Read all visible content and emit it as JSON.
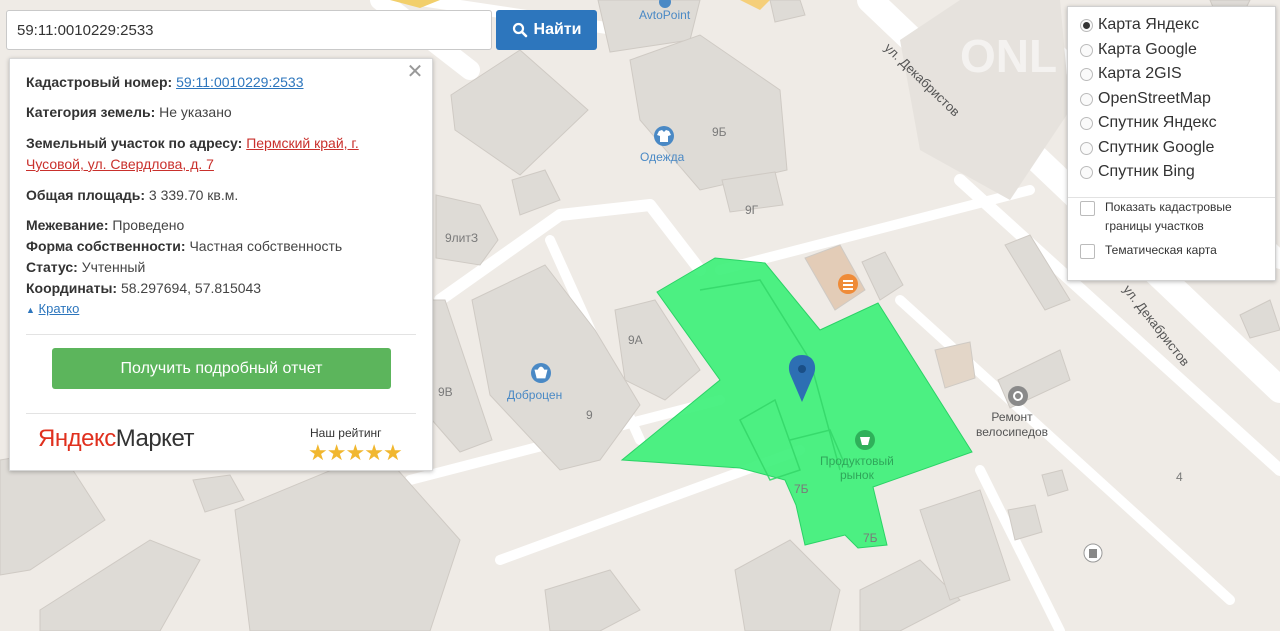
{
  "search": {
    "value": "59:11:0010229:2533",
    "button_label": "Найти",
    "button_icon": "search-icon"
  },
  "info": {
    "cadastral_label": "Кадастровый номер:",
    "cadastral_value": "59:11:0010229:2533",
    "category_label": "Категория земель:",
    "category_value": "Не указано",
    "address_label": "Земельный участок по адресу:",
    "address_line1": "Пермский край, г.",
    "address_line2": "Чусовой, ул. Свердлова, д. 7",
    "area_label": "Общая площадь:",
    "area_value": "3 339.70 кв.м.",
    "survey_label": "Межевание:",
    "survey_value": "Проведено",
    "ownership_label": "Форма собственности:",
    "ownership_value": "Частная собственность",
    "status_label": "Статус:",
    "status_value": "Учтенный",
    "coords_label": "Координаты:",
    "coords_value": "58.297694, 57.815043",
    "collapse_label": "Кратко",
    "report_button": "Получить подробный отчет",
    "ad_logo_part1": "Яндекс",
    "ad_logo_part2": "Маркет",
    "rating_label": "Наш рейтинг",
    "rating_stars": 5
  },
  "layers": {
    "options": [
      {
        "label": "Карта Яндекс",
        "selected": true
      },
      {
        "label": "Карта Google",
        "selected": false
      },
      {
        "label": "Карта 2GIS",
        "selected": false
      },
      {
        "label": "OpenStreetMap",
        "selected": false
      },
      {
        "label": "Спутник Яндекс",
        "selected": false
      },
      {
        "label": "Спутник Google",
        "selected": false
      },
      {
        "label": "Спутник Bing",
        "selected": false
      }
    ],
    "show_borders_line1": "Показать кадастровые",
    "show_borders_line2": "границы участков",
    "thematic_label": "Тематическая карта"
  },
  "map": {
    "poi": {
      "avtopoint": "AvtoPoint",
      "odezhda": "Одежда",
      "dobrocen": "Доброцен",
      "market_line1": "Продуктовый",
      "market_line2": "рынок",
      "repair_line1": "Ремонт",
      "repair_line2": "велосипедов"
    },
    "streets": {
      "dekabristov_1": "ул. Декабристов",
      "dekabristov_2": "ул. Декабристов"
    },
    "houses": {
      "h9b": "9Б",
      "h9g": "9Г",
      "h9lit3": "9литЗ",
      "h9a": "9А",
      "h9v": "9В",
      "h9": "9",
      "h7b1": "7Б",
      "h7b2": "7Б",
      "h4": "4"
    },
    "parcel_color": "#3ef07a",
    "marker_color": "#2d6fb3"
  }
}
